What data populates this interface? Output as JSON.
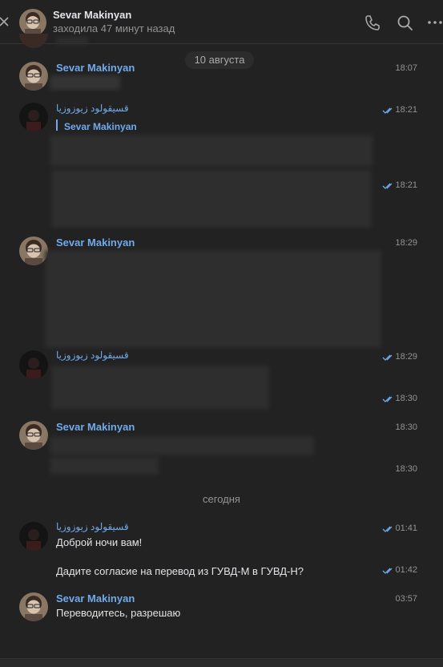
{
  "header": {
    "name": "Sevar Makinyan",
    "status": "заходила 47 минут назад"
  },
  "users": {
    "sevar": "Sevar Makinyan",
    "other": "ﻗﺴﻴﻘﻮﻟﻮﺩ ﺯﻳﻮﺯﻭﺯﻳﺎ"
  },
  "dates": {
    "aug10": "10 августа",
    "today": "сегодня"
  },
  "messages": {
    "m1_time": "18:07",
    "m2_time": "18:21",
    "m2_reply_to": "Sevar Makinyan",
    "m3_time": "18:21",
    "m4_time": "18:29",
    "m5_time": "18:29",
    "m6_time": "18:30",
    "m7_time": "18:30",
    "m8_time": "18:30",
    "m9_time": "01:41",
    "m9_text": "Доброй ночи вам!",
    "m10_time": "01:42",
    "m10_text": "Дадите согласие на перевод из ГУВД-М в ГУВД-Н?",
    "m11_time": "03:57",
    "m11_text": "Переводитесь, разрешаю"
  },
  "colors": {
    "accent": "#71aaeb",
    "background": "#222222",
    "muted": "#939393"
  }
}
